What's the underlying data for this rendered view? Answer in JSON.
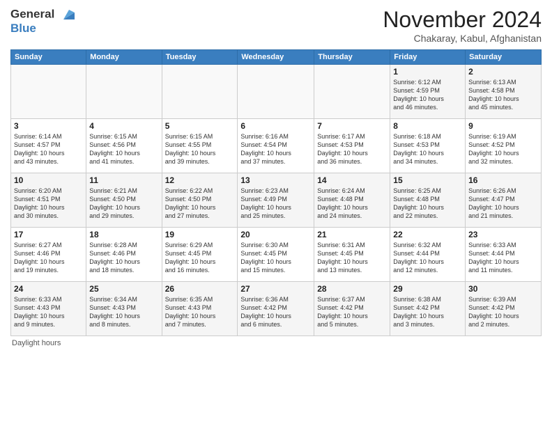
{
  "header": {
    "logo_line1": "General",
    "logo_line2": "Blue",
    "month": "November 2024",
    "location": "Chakaray, Kabul, Afghanistan"
  },
  "days_of_week": [
    "Sunday",
    "Monday",
    "Tuesday",
    "Wednesday",
    "Thursday",
    "Friday",
    "Saturday"
  ],
  "footer": "Daylight hours",
  "weeks": [
    [
      {
        "day": "",
        "info": ""
      },
      {
        "day": "",
        "info": ""
      },
      {
        "day": "",
        "info": ""
      },
      {
        "day": "",
        "info": ""
      },
      {
        "day": "",
        "info": ""
      },
      {
        "day": "1",
        "info": "Sunrise: 6:12 AM\nSunset: 4:59 PM\nDaylight: 10 hours\nand 46 minutes."
      },
      {
        "day": "2",
        "info": "Sunrise: 6:13 AM\nSunset: 4:58 PM\nDaylight: 10 hours\nand 45 minutes."
      }
    ],
    [
      {
        "day": "3",
        "info": "Sunrise: 6:14 AM\nSunset: 4:57 PM\nDaylight: 10 hours\nand 43 minutes."
      },
      {
        "day": "4",
        "info": "Sunrise: 6:15 AM\nSunset: 4:56 PM\nDaylight: 10 hours\nand 41 minutes."
      },
      {
        "day": "5",
        "info": "Sunrise: 6:15 AM\nSunset: 4:55 PM\nDaylight: 10 hours\nand 39 minutes."
      },
      {
        "day": "6",
        "info": "Sunrise: 6:16 AM\nSunset: 4:54 PM\nDaylight: 10 hours\nand 37 minutes."
      },
      {
        "day": "7",
        "info": "Sunrise: 6:17 AM\nSunset: 4:53 PM\nDaylight: 10 hours\nand 36 minutes."
      },
      {
        "day": "8",
        "info": "Sunrise: 6:18 AM\nSunset: 4:53 PM\nDaylight: 10 hours\nand 34 minutes."
      },
      {
        "day": "9",
        "info": "Sunrise: 6:19 AM\nSunset: 4:52 PM\nDaylight: 10 hours\nand 32 minutes."
      }
    ],
    [
      {
        "day": "10",
        "info": "Sunrise: 6:20 AM\nSunset: 4:51 PM\nDaylight: 10 hours\nand 30 minutes."
      },
      {
        "day": "11",
        "info": "Sunrise: 6:21 AM\nSunset: 4:50 PM\nDaylight: 10 hours\nand 29 minutes."
      },
      {
        "day": "12",
        "info": "Sunrise: 6:22 AM\nSunset: 4:50 PM\nDaylight: 10 hours\nand 27 minutes."
      },
      {
        "day": "13",
        "info": "Sunrise: 6:23 AM\nSunset: 4:49 PM\nDaylight: 10 hours\nand 25 minutes."
      },
      {
        "day": "14",
        "info": "Sunrise: 6:24 AM\nSunset: 4:48 PM\nDaylight: 10 hours\nand 24 minutes."
      },
      {
        "day": "15",
        "info": "Sunrise: 6:25 AM\nSunset: 4:48 PM\nDaylight: 10 hours\nand 22 minutes."
      },
      {
        "day": "16",
        "info": "Sunrise: 6:26 AM\nSunset: 4:47 PM\nDaylight: 10 hours\nand 21 minutes."
      }
    ],
    [
      {
        "day": "17",
        "info": "Sunrise: 6:27 AM\nSunset: 4:46 PM\nDaylight: 10 hours\nand 19 minutes."
      },
      {
        "day": "18",
        "info": "Sunrise: 6:28 AM\nSunset: 4:46 PM\nDaylight: 10 hours\nand 18 minutes."
      },
      {
        "day": "19",
        "info": "Sunrise: 6:29 AM\nSunset: 4:45 PM\nDaylight: 10 hours\nand 16 minutes."
      },
      {
        "day": "20",
        "info": "Sunrise: 6:30 AM\nSunset: 4:45 PM\nDaylight: 10 hours\nand 15 minutes."
      },
      {
        "day": "21",
        "info": "Sunrise: 6:31 AM\nSunset: 4:45 PM\nDaylight: 10 hours\nand 13 minutes."
      },
      {
        "day": "22",
        "info": "Sunrise: 6:32 AM\nSunset: 4:44 PM\nDaylight: 10 hours\nand 12 minutes."
      },
      {
        "day": "23",
        "info": "Sunrise: 6:33 AM\nSunset: 4:44 PM\nDaylight: 10 hours\nand 11 minutes."
      }
    ],
    [
      {
        "day": "24",
        "info": "Sunrise: 6:33 AM\nSunset: 4:43 PM\nDaylight: 10 hours\nand 9 minutes."
      },
      {
        "day": "25",
        "info": "Sunrise: 6:34 AM\nSunset: 4:43 PM\nDaylight: 10 hours\nand 8 minutes."
      },
      {
        "day": "26",
        "info": "Sunrise: 6:35 AM\nSunset: 4:43 PM\nDaylight: 10 hours\nand 7 minutes."
      },
      {
        "day": "27",
        "info": "Sunrise: 6:36 AM\nSunset: 4:42 PM\nDaylight: 10 hours\nand 6 minutes."
      },
      {
        "day": "28",
        "info": "Sunrise: 6:37 AM\nSunset: 4:42 PM\nDaylight: 10 hours\nand 5 minutes."
      },
      {
        "day": "29",
        "info": "Sunrise: 6:38 AM\nSunset: 4:42 PM\nDaylight: 10 hours\nand 3 minutes."
      },
      {
        "day": "30",
        "info": "Sunrise: 6:39 AM\nSunset: 4:42 PM\nDaylight: 10 hours\nand 2 minutes."
      }
    ]
  ]
}
